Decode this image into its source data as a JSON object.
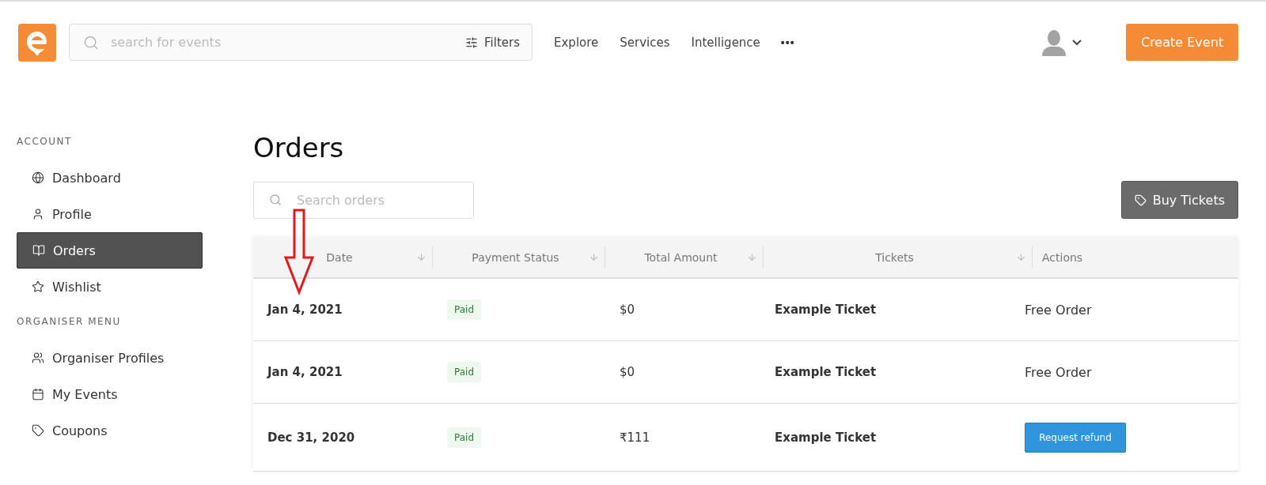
{
  "header": {
    "search": {
      "placeholder": "search for events"
    },
    "filters_label": "Filters",
    "nav": [
      "Explore",
      "Services",
      "Intelligence"
    ],
    "more": "•••",
    "create_button": "Create Event"
  },
  "sidebar": {
    "sections": [
      {
        "title": "ACCOUNT",
        "items": [
          {
            "label": "Dashboard",
            "selected": false
          },
          {
            "label": "Profile",
            "selected": false
          },
          {
            "label": "Orders",
            "selected": true
          },
          {
            "label": "Wishlist",
            "selected": false
          }
        ]
      },
      {
        "title": "ORGANISER MENU",
        "items": [
          {
            "label": "Organiser Profiles",
            "selected": false
          },
          {
            "label": "My Events",
            "selected": false
          },
          {
            "label": "Coupons",
            "selected": false
          }
        ]
      }
    ]
  },
  "page": {
    "title": "Orders",
    "search": {
      "placeholder": "Search orders"
    },
    "buy_button": "Buy Tickets"
  },
  "table": {
    "columns": [
      {
        "label": "Date",
        "sortable": true
      },
      {
        "label": "Payment Status",
        "sortable": true
      },
      {
        "label": "Total Amount",
        "sortable": true
      },
      {
        "label": "Tickets",
        "sortable": true
      },
      {
        "label": "Actions",
        "sortable": false
      }
    ],
    "rows": [
      {
        "date": "Jan 4, 2021",
        "status": "Paid",
        "amount": "$0",
        "ticket": "Example Ticket",
        "action": {
          "kind": "text",
          "label": "Free Order"
        }
      },
      {
        "date": "Jan 4, 2021",
        "status": "Paid",
        "amount": "$0",
        "ticket": "Example Ticket",
        "action": {
          "kind": "text",
          "label": "Free Order"
        }
      },
      {
        "date": "Dec 31, 2020",
        "status": "Paid",
        "amount": "₹111",
        "ticket": "Example Ticket",
        "action": {
          "kind": "button",
          "label": "Request refund"
        }
      }
    ]
  },
  "annotation": {
    "kind": "arrow"
  }
}
